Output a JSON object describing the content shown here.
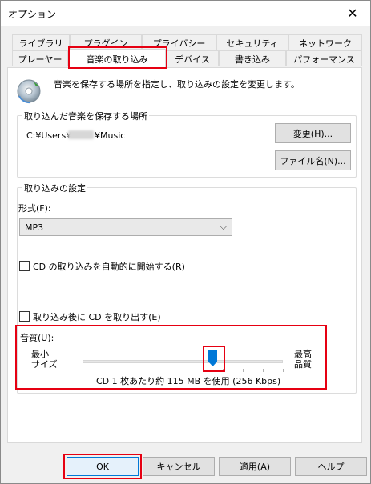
{
  "window": {
    "title": "オプション"
  },
  "tabs_row1": [
    "ライブラリ",
    "プラグイン",
    "プライバシー",
    "セキュリティ",
    "ネットワーク"
  ],
  "tabs_row2": [
    "プレーヤー",
    "音楽の取り込み",
    "デバイス",
    "書き込み",
    "パフォーマンス"
  ],
  "active_tab": "音楽の取り込み",
  "description": "音楽を保存する場所を指定し、取り込みの設定を変更します。",
  "location": {
    "legend": "取り込んだ音楽を保存する場所",
    "path_prefix": "C:¥Users¥",
    "path_suffix": "¥Music",
    "change_button": "変更(H)...",
    "filename_button": "ファイル名(N)..."
  },
  "rip": {
    "legend": "取り込みの設定",
    "format_label": "形式(F):",
    "format_value": "MP3",
    "auto_rip_label": "CD の取り込みを自動的に開始する(R)",
    "auto_rip_checked": false,
    "eject_label": "取り込み後に CD を取り出す(E)",
    "eject_checked": false,
    "quality_label": "音質(U):",
    "min_label_1": "最小",
    "min_label_2": "サイズ",
    "max_label_1": "最高",
    "max_label_2": "品質",
    "quality_level_fraction": 0.65,
    "usage_text": "CD 1 枚あたり約 115 MB を使用 (256 Kbps)"
  },
  "buttons": {
    "ok": "OK",
    "cancel": "キャンセル",
    "apply": "適用(A)",
    "help": "ヘルプ"
  },
  "colors": {
    "highlight": "#e60012",
    "slider_thumb": "#0078d7"
  }
}
